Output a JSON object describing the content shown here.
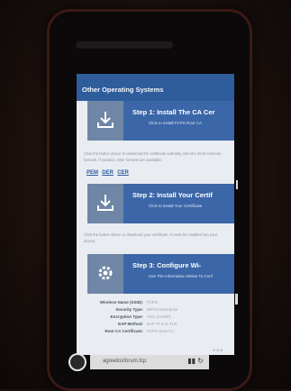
{
  "screen": {
    "header": "Other Operating Systems",
    "steps": [
      {
        "title": "Step 1: Install The CA Cer",
        "subtitle": "Click to install FCPS Root CA",
        "icon": "download-icon"
      },
      {
        "title": "Step 2: Install Your Certif",
        "subtitle": "Click to install Your Certificate",
        "icon": "download-icon"
      },
      {
        "title": "Step 3: Configure Wi-",
        "subtitle": "Use The Information Below To Conf",
        "icon": "gear-icon"
      }
    ],
    "para1": "Click the button above to download the certificate authority onto the most common formats. If needed, other formats are available:",
    "links": [
      "PEM",
      "DER",
      "CER"
    ],
    "para2": "Click the button above to download your certificate. It must be installed into your device.",
    "network": [
      {
        "key": "Wireless Name (SSID):",
        "value": "FCPS"
      },
      {
        "key": "Security Type:",
        "value": "WPA2-Enterprise"
      },
      {
        "key": "Encryption Type:",
        "value": "AES (CCMP)"
      },
      {
        "key": "EAP Method:",
        "value": "EAP-TLS or TLS"
      },
      {
        "key": "Root CA Certificate:",
        "value": "FCPS Root CA"
      }
    ]
  },
  "browser": {
    "url": "agreetosforum.fcp",
    "menu": "•••"
  }
}
